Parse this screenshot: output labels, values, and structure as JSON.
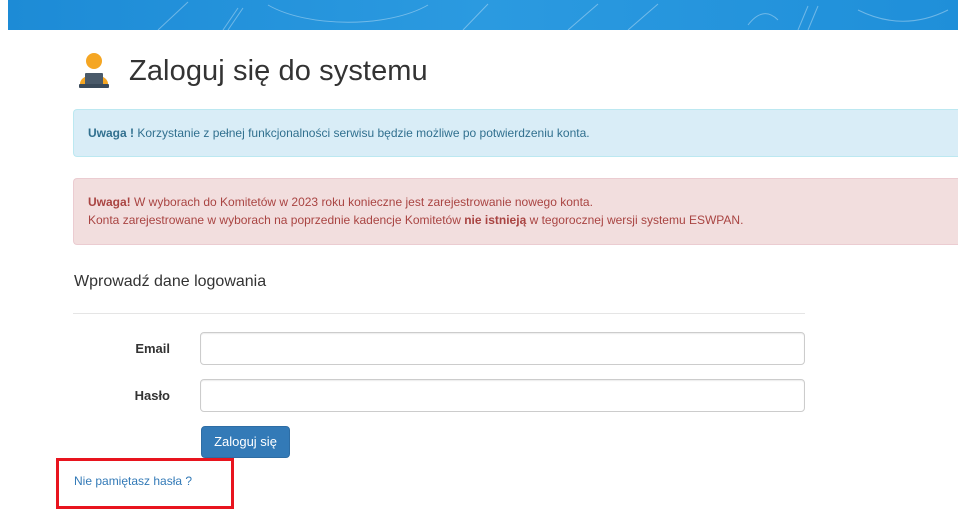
{
  "header": {
    "title": "Zaloguj się do systemu"
  },
  "alerts": {
    "info": {
      "strong": "Uwaga !",
      "text": " Korzystanie z pełnej funkcjonalności serwisu będzie możliwe po potwierdzeniu konta."
    },
    "danger": {
      "line1_strong": "Uwaga!",
      "line1_text": " W wyborach do Komitetów w 2023 roku konieczne jest zarejestrowanie nowego konta.",
      "line2_before": "Konta zarejestrowane w wyborach na poprzednie kadencje Komitetów ",
      "line2_strong": "nie istnieją",
      "line2_after": " w tegorocznej wersji systemu ESWPAN."
    }
  },
  "form": {
    "section_title": "Wprowadź dane logowania",
    "email_label": "Email",
    "email_value": "",
    "password_label": "Hasło",
    "password_value": "",
    "submit_label": "Zaloguj się",
    "forgot_link": "Nie pamiętasz hasła ?"
  },
  "colors": {
    "banner": "#1d8bd6",
    "primary_button": "#337ab7",
    "info_bg": "#d9edf7",
    "danger_bg": "#f2dede",
    "highlight": "#e8141e"
  },
  "icons": {
    "title_icon": "user-at-laptop-icon"
  }
}
